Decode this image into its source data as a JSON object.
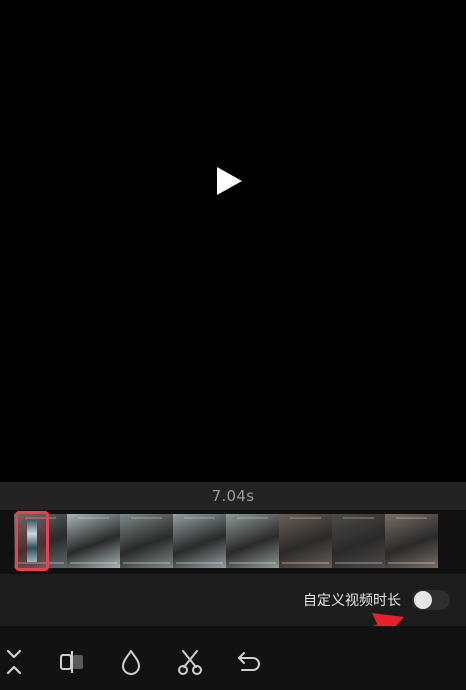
{
  "preview": {
    "play_icon": "play-icon"
  },
  "timeline": {
    "duration": "7.04s",
    "frame_colors": [
      "#5e6b6c",
      "#a9b7b8",
      "#7d8a87",
      "#93a1a4",
      "#8f9b95",
      "#6b5f54",
      "#4e4a48",
      "#7a6d64"
    ]
  },
  "options": {
    "custom_duration_label": "自定义视频时长",
    "custom_duration_enabled": false
  },
  "toolbar": {
    "icons": [
      "collapse-icon",
      "split-screen-icon",
      "color-drop-icon",
      "scissors-icon",
      "undo-icon"
    ]
  },
  "colors": {
    "selection_border": "#e8424f",
    "annotation_arrow": "#e8202b"
  }
}
